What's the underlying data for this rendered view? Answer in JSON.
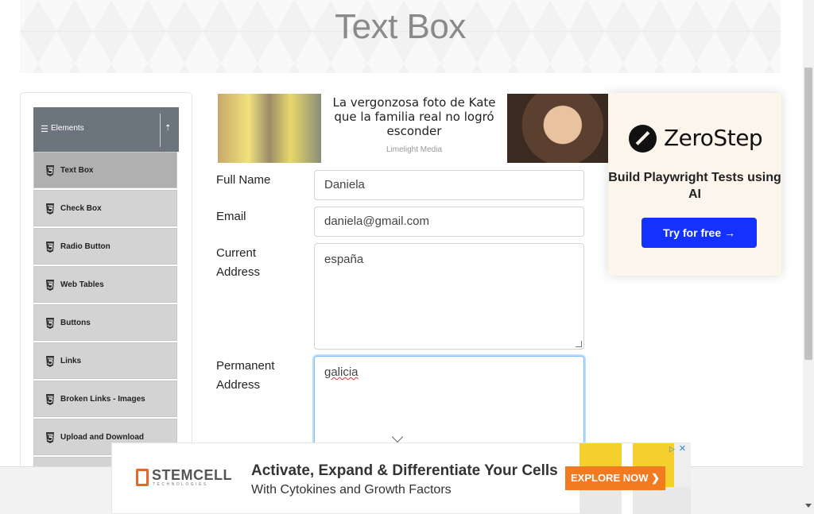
{
  "header": {
    "title": "Text Box"
  },
  "sidebar": {
    "group_label": "Elements",
    "items": [
      {
        "label": "Text Box",
        "active": true
      },
      {
        "label": "Check Box"
      },
      {
        "label": "Radio Button"
      },
      {
        "label": "Web Tables"
      },
      {
        "label": "Buttons"
      },
      {
        "label": "Links"
      },
      {
        "label": "Broken Links - Images"
      },
      {
        "label": "Upload and Download"
      }
    ]
  },
  "ad_top": {
    "headline": "La vergonzosa foto de Kate que la familia real no logró esconder",
    "source": "Limelight Media"
  },
  "ad_side": {
    "brand": "ZeroStep",
    "tagline": "Build Playwright Tests using AI",
    "cta": "Try for free →"
  },
  "form": {
    "full_name": {
      "label": "Full Name",
      "value": "Daniela"
    },
    "email": {
      "label": "Email",
      "value": "daniela@gmail.com"
    },
    "current_address": {
      "label_line1": "Current",
      "label_line2": "Address",
      "value": "españa"
    },
    "permanent_address": {
      "label_line1": "Permanent",
      "label_line2": "Address",
      "value": "galicia"
    }
  },
  "ad_bottom": {
    "brand": "STEMCELL",
    "brand_sub": "TECHNOLOGIES",
    "headline": "Activate, Expand & Differentiate Your Cells",
    "subline": "With Cytokines and Growth Factors",
    "cta": "EXPLORE NOW ❯"
  },
  "colors": {
    "menu_header": "#6c757d",
    "cta_blue": "#1432ff",
    "explore_orange": "#f27b22"
  }
}
